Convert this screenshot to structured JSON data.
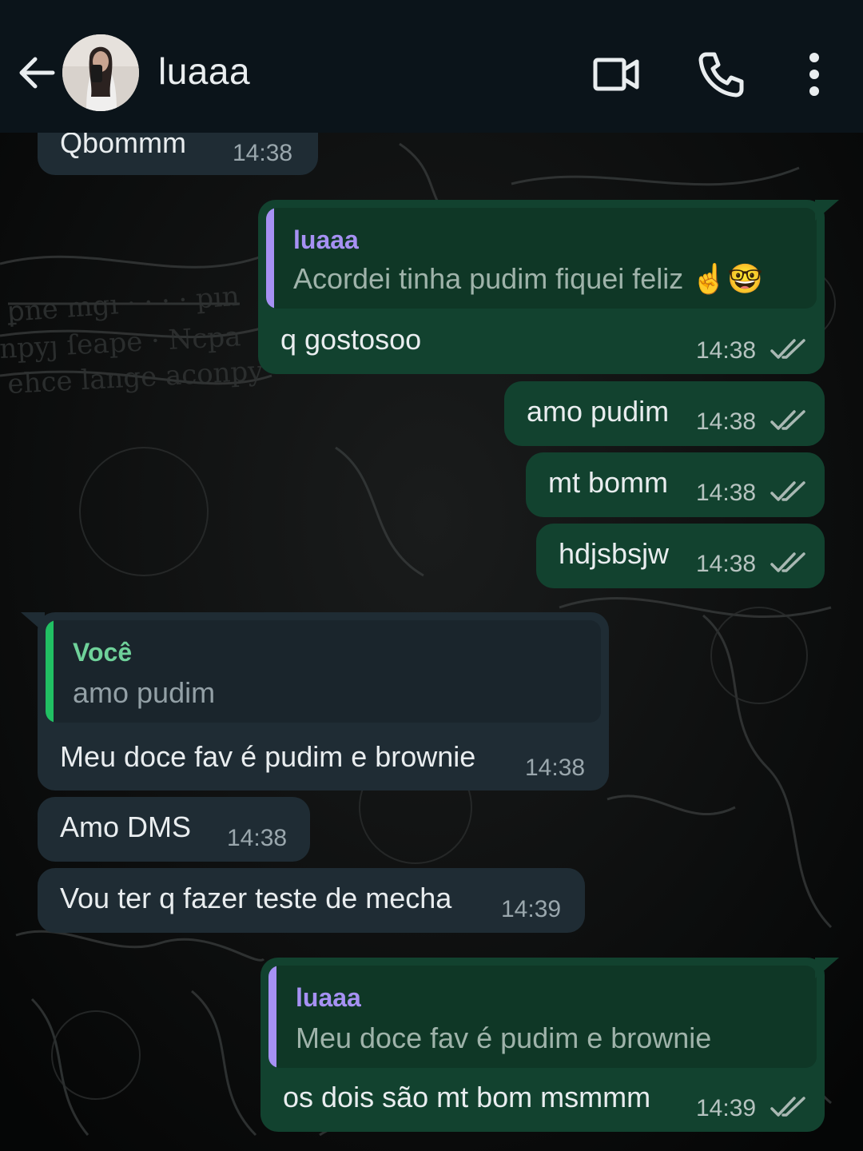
{
  "header": {
    "contact_name": "luaaa",
    "back_icon": "arrow-left-icon",
    "video_icon": "video-camera-icon",
    "call_icon": "phone-icon",
    "menu_icon": "more-vertical-icon"
  },
  "colors": {
    "header_bg": "#0b141a",
    "incoming_bubble": "#1f2c34",
    "outgoing_bubble": "#12422f",
    "quote_accent_purple": "#a691f3",
    "quote_accent_green": "#21c063",
    "read_ticks": "#a9b8b3"
  },
  "messages": [
    {
      "text": "Qbommm",
      "time": "14:38"
    },
    {
      "quote_author": "luaaa",
      "quote_text": "Acordei tinha pudim fiquei feliz",
      "quote_emojis": "☝️🤓",
      "text": "q gostosoo",
      "time": "14:38"
    },
    {
      "text": "amo pudim",
      "time": "14:38"
    },
    {
      "text": "mt bomm",
      "time": "14:38"
    },
    {
      "text": "hdjsbsjw",
      "time": "14:38"
    },
    {
      "quote_author": "Você",
      "quote_text": "amo pudim",
      "text": "Meu doce fav é pudim e brownie",
      "time": "14:38"
    },
    {
      "text": "Amo DMS",
      "time": "14:38"
    },
    {
      "text": "Vou ter q fazer teste de mecha",
      "time": "14:39"
    },
    {
      "quote_author": "luaaa",
      "quote_text": "Meu doce fav é pudim e brownie",
      "text": "os dois são mt bom msmmm",
      "time": "14:39"
    }
  ]
}
